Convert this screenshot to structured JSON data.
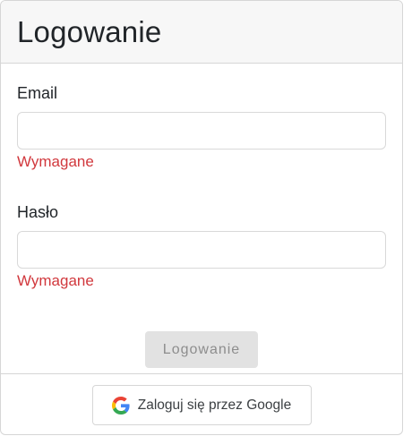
{
  "header": {
    "title": "Logowanie"
  },
  "form": {
    "email": {
      "label": "Email",
      "value": "",
      "placeholder": "",
      "error": "Wymagane"
    },
    "password": {
      "label": "Hasło",
      "value": "",
      "placeholder": "",
      "error": "Wymagane"
    },
    "submit_label": "Logowanie"
  },
  "footer": {
    "google_label": "Zaloguj się przez Google",
    "icon": "google-icon"
  },
  "colors": {
    "error": "#d1383d",
    "header_bg": "#f7f7f7",
    "disabled_button_bg": "#e2e2e2",
    "disabled_button_text": "#8d8d8d"
  }
}
